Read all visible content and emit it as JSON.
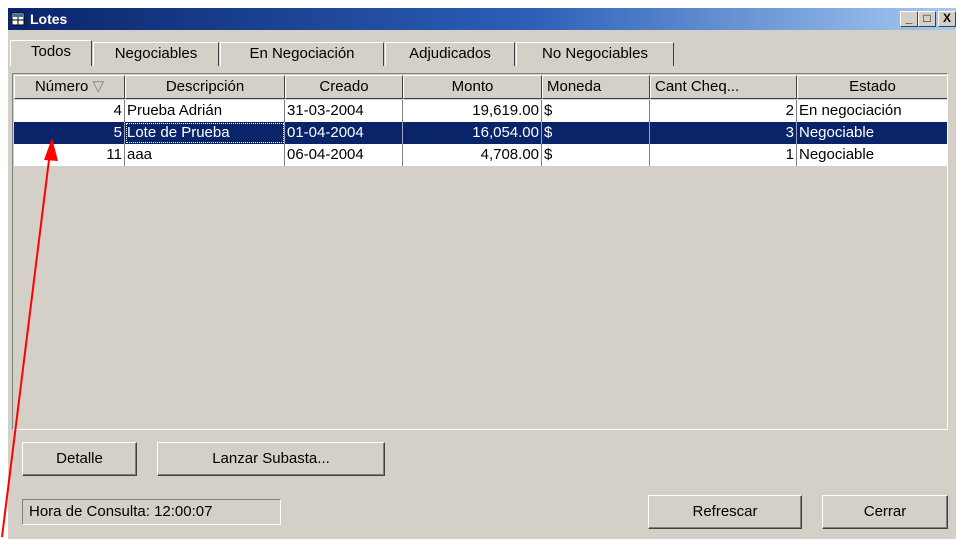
{
  "window": {
    "title": "Lotes",
    "min": "_",
    "max": "□",
    "close": "X"
  },
  "tabs": [
    {
      "label": "Todos"
    },
    {
      "label": "Negociables"
    },
    {
      "label": "En Negociación"
    },
    {
      "label": "Adjudicados"
    },
    {
      "label": "No Negociables"
    }
  ],
  "table": {
    "headers": [
      "Número",
      "Descripción",
      "Creado",
      "Monto",
      "Moneda",
      "Cant Cheq...",
      "Estado"
    ],
    "sort_indicator": "▽",
    "rows": [
      {
        "numero": "4",
        "descripcion": "Prueba Adrián",
        "creado": "31-03-2004",
        "monto": "19,619.00",
        "moneda": "$",
        "cant": "2",
        "estado": "En negociación"
      },
      {
        "numero": "5",
        "descripcion": "Lote de Prueba",
        "creado": "01-04-2004",
        "monto": "16,054.00",
        "moneda": "$",
        "cant": "3",
        "estado": "Negociable"
      },
      {
        "numero": "11",
        "descripcion": "aaa",
        "creado": "06-04-2004",
        "monto": "4,708.00",
        "moneda": "$",
        "cant": "1",
        "estado": "Negociable"
      }
    ]
  },
  "buttons": {
    "detalle": "Detalle",
    "lanzar": "Lanzar Subasta...",
    "refrescar": "Refrescar",
    "cerrar": "Cerrar"
  },
  "status": {
    "hora": "Hora de Consulta: 12:00:07"
  },
  "colors": {
    "selection": "#0a246a",
    "arrow": "#ff0000",
    "titlebar": "#0a246a"
  }
}
